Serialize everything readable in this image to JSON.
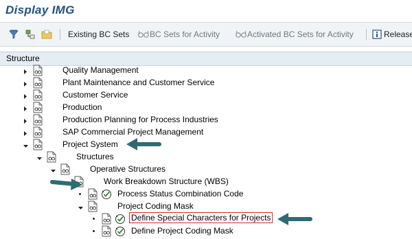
{
  "window": {
    "title": "Display IMG"
  },
  "toolbar": {
    "existing_bc_sets": "Existing BC Sets",
    "bc_sets_for_activity": "BC Sets for Activity",
    "activated_bc_sets": "Activated BC Sets for Activity",
    "release": "Release"
  },
  "tree": {
    "header": "Structure",
    "items": [
      {
        "label": "Quality Management"
      },
      {
        "label": "Plant Maintenance and Customer Service"
      },
      {
        "label": "Customer Service"
      },
      {
        "label": "Production"
      },
      {
        "label": "Production Planning for Process Industries"
      },
      {
        "label": "SAP Commercial Project Management"
      },
      {
        "label": "Project System"
      },
      {
        "label": "Structures"
      },
      {
        "label": "Operative Structures"
      },
      {
        "label": "Work Breakdown Structure (WBS)"
      },
      {
        "label": "Process Status Combination Code"
      },
      {
        "label": "Project Coding Mask"
      },
      {
        "label": "Define Special Characters for Projects"
      },
      {
        "label": "Define Project Coding Mask"
      }
    ]
  },
  "colors": {
    "arrow": "#2e6b72",
    "highlight_box": "#d42a2a",
    "title": "#21527d"
  }
}
